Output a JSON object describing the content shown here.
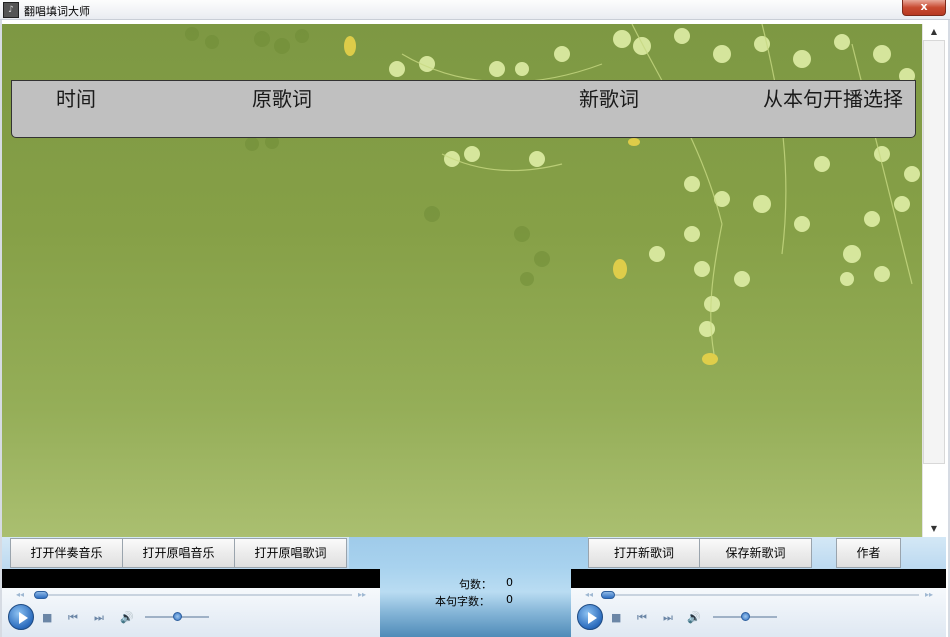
{
  "window": {
    "title": "翻唱填词大师",
    "close_label": "x"
  },
  "lyric_header": {
    "col_time": "时间",
    "col_original": "原歌词",
    "col_new": "新歌词",
    "col_play_from": "从本句开播选择"
  },
  "toolbar_left": {
    "open_accompaniment": "打开伴奏音乐",
    "open_original_music": "打开原唱音乐",
    "open_original_lyrics": "打开原唱歌词"
  },
  "toolbar_right": {
    "open_new_lyrics": "打开新歌词",
    "save_new_lyrics": "保存新歌词",
    "author": "作者"
  },
  "stats": {
    "sentence_count_label": "句数：",
    "sentence_count_value": "0",
    "char_count_label": "本句字数：",
    "char_count_value": "0"
  },
  "players": {
    "left": {
      "seek_fraction": 0.0,
      "volume_fraction": 0.5
    },
    "right": {
      "seek_fraction": 0.0,
      "volume_fraction": 0.5
    }
  },
  "colors": {
    "background_green": "#86a047",
    "header_gray": "#c0c0c0",
    "button_strip_blue": "#bcd9f0"
  },
  "icons": [
    "app-icon",
    "close-icon",
    "play-icon",
    "stop-icon",
    "previous-icon",
    "next-icon",
    "volume-icon"
  ]
}
